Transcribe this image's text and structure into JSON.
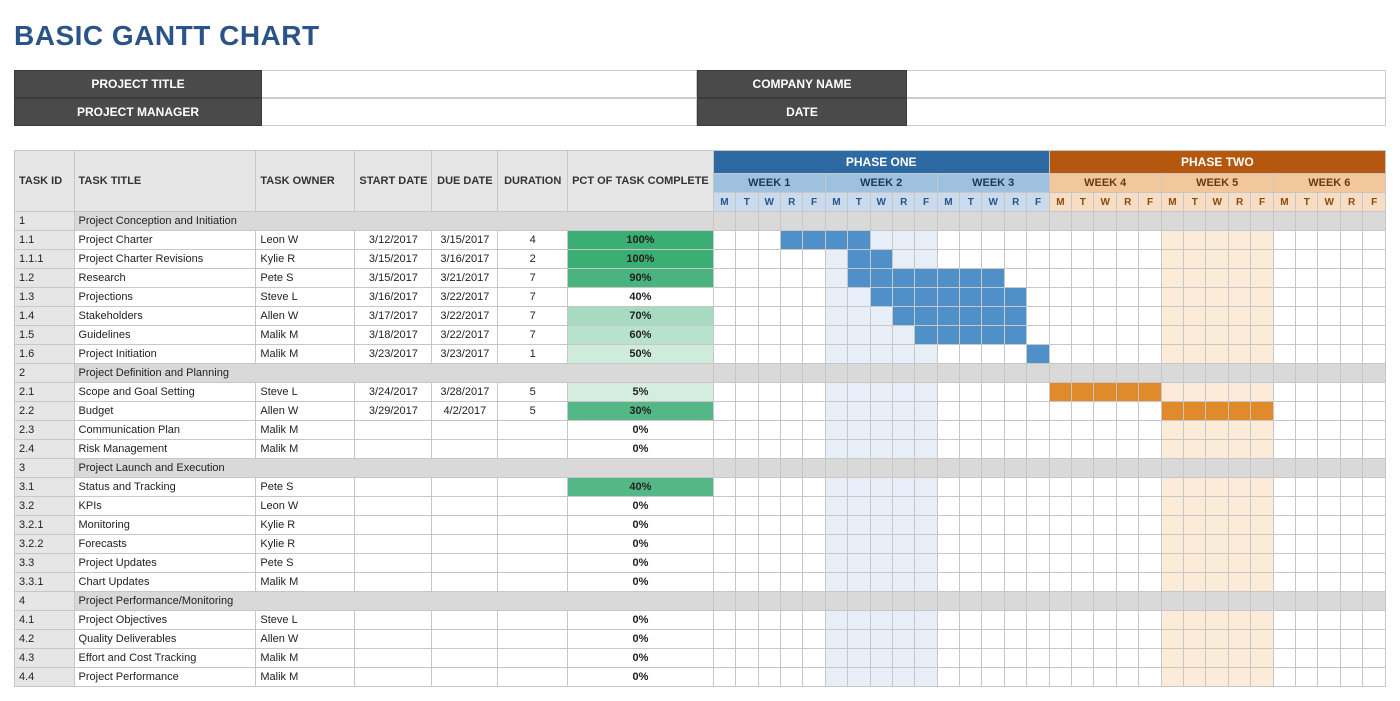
{
  "title": "BASIC GANTT CHART",
  "meta": {
    "project_title_label": "PROJECT TITLE",
    "project_title_value": "",
    "project_manager_label": "PROJECT MANAGER",
    "project_manager_value": "",
    "company_name_label": "COMPANY NAME",
    "company_name_value": "",
    "date_label": "DATE",
    "date_value": ""
  },
  "columns": {
    "task_id": "TASK ID",
    "task_title": "TASK TITLE",
    "task_owner": "TASK OWNER",
    "start_date": "START DATE",
    "due_date": "DUE DATE",
    "duration": "DURATION",
    "pct": "PCT OF TASK COMPLETE"
  },
  "phases": [
    {
      "label": "PHASE ONE",
      "weeks": [
        "WEEK 1",
        "WEEK 2",
        "WEEK 3"
      ],
      "color": "blue"
    },
    {
      "label": "PHASE TWO",
      "weeks": [
        "WEEK 4",
        "WEEK 5",
        "WEEK 6"
      ],
      "color": "orange"
    }
  ],
  "days": [
    "M",
    "T",
    "W",
    "R",
    "F"
  ],
  "shaded_blue_cols": [
    5,
    6,
    7,
    8,
    9
  ],
  "shaded_orange_cols": [
    20,
    21,
    22,
    23,
    24
  ],
  "rows": [
    {
      "section": true,
      "id": "1",
      "title": "Project Conception and Initiation"
    },
    {
      "id": "1.1",
      "title": "Project Charter",
      "owner": "Leon W",
      "start": "3/12/2017",
      "due": "3/15/2017",
      "dur": "4",
      "pct": "100%",
      "pctShade": 1.0,
      "bar": [
        3,
        4,
        5,
        6
      ]
    },
    {
      "id": "1.1.1",
      "title": "Project Charter Revisions",
      "owner": "Kylie R",
      "start": "3/15/2017",
      "due": "3/16/2017",
      "dur": "2",
      "pct": "100%",
      "pctShade": 1.0,
      "bar": [
        6,
        7
      ]
    },
    {
      "id": "1.2",
      "title": "Research",
      "owner": "Pete S",
      "start": "3/15/2017",
      "due": "3/21/2017",
      "dur": "7",
      "pct": "90%",
      "pctShade": 0.9,
      "bar": [
        6,
        7,
        8,
        9,
        10,
        11,
        12
      ]
    },
    {
      "id": "1.3",
      "title": "Projections",
      "owner": "Steve L",
      "start": "3/16/2017",
      "due": "3/22/2017",
      "dur": "7",
      "pct": "40%",
      "pctShade": 0.0,
      "bar": [
        7,
        8,
        9,
        10,
        11,
        12,
        13
      ]
    },
    {
      "id": "1.4",
      "title": "Stakeholders",
      "owner": "Allen W",
      "start": "3/17/2017",
      "due": "3/22/2017",
      "dur": "7",
      "pct": "70%",
      "pctShade": 0.35,
      "bar": [
        8,
        9,
        10,
        11,
        12,
        13
      ]
    },
    {
      "id": "1.5",
      "title": "Guidelines",
      "owner": "Malik M",
      "start": "3/18/2017",
      "due": "3/22/2017",
      "dur": "7",
      "pct": "60%",
      "pctShade": 0.25,
      "bar": [
        9,
        10,
        11,
        12,
        13
      ]
    },
    {
      "id": "1.6",
      "title": "Project Initiation",
      "owner": "Malik M",
      "start": "3/23/2017",
      "due": "3/23/2017",
      "dur": "1",
      "pct": "50%",
      "pctShade": 0.12,
      "bar": [
        14
      ]
    },
    {
      "section": true,
      "id": "2",
      "title": "Project Definition and Planning"
    },
    {
      "id": "2.1",
      "title": "Scope and Goal Setting",
      "owner": "Steve L",
      "start": "3/24/2017",
      "due": "3/28/2017",
      "dur": "5",
      "pct": "5%",
      "pctShade": 0.08,
      "bar": [
        15,
        16,
        17,
        18,
        19
      ]
    },
    {
      "id": "2.2",
      "title": "Budget",
      "owner": "Allen W",
      "start": "3/29/2017",
      "due": "4/2/2017",
      "dur": "5",
      "pct": "30%",
      "pctShade": 0.85,
      "bar": [
        20,
        21,
        22,
        23,
        24
      ]
    },
    {
      "id": "2.3",
      "title": "Communication Plan",
      "owner": "Malik M",
      "start": "",
      "due": "",
      "dur": "",
      "pct": "0%",
      "pctShade": 0.0,
      "bar": []
    },
    {
      "id": "2.4",
      "title": "Risk Management",
      "owner": "Malik M",
      "start": "",
      "due": "",
      "dur": "",
      "pct": "0%",
      "pctShade": 0.0,
      "bar": []
    },
    {
      "section": true,
      "id": "3",
      "title": "Project Launch and Execution"
    },
    {
      "id": "3.1",
      "title": "Status and Tracking",
      "owner": "Pete S",
      "start": "",
      "due": "",
      "dur": "",
      "pct": "40%",
      "pctShade": 0.85,
      "bar": []
    },
    {
      "id": "3.2",
      "title": "KPIs",
      "owner": "Leon W",
      "start": "",
      "due": "",
      "dur": "",
      "pct": "0%",
      "pctShade": 0.0,
      "bar": []
    },
    {
      "id": "3.2.1",
      "title": "Monitoring",
      "owner": "Kylie R",
      "start": "",
      "due": "",
      "dur": "",
      "pct": "0%",
      "pctShade": 0.0,
      "bar": []
    },
    {
      "id": "3.2.2",
      "title": "Forecasts",
      "owner": "Kylie R",
      "start": "",
      "due": "",
      "dur": "",
      "pct": "0%",
      "pctShade": 0.0,
      "bar": []
    },
    {
      "id": "3.3",
      "title": "Project Updates",
      "owner": "Pete S",
      "start": "",
      "due": "",
      "dur": "",
      "pct": "0%",
      "pctShade": 0.0,
      "bar": []
    },
    {
      "id": "3.3.1",
      "title": "Chart Updates",
      "owner": "Malik M",
      "start": "",
      "due": "",
      "dur": "",
      "pct": "0%",
      "pctShade": 0.0,
      "bar": []
    },
    {
      "section": true,
      "id": "4",
      "title": "Project Performance/Monitoring"
    },
    {
      "id": "4.1",
      "title": "Project Objectives",
      "owner": "Steve L",
      "start": "",
      "due": "",
      "dur": "",
      "pct": "0%",
      "pctShade": 0.0,
      "bar": []
    },
    {
      "id": "4.2",
      "title": "Quality Deliverables",
      "owner": "Allen W",
      "start": "",
      "due": "",
      "dur": "",
      "pct": "0%",
      "pctShade": 0.0,
      "bar": []
    },
    {
      "id": "4.3",
      "title": "Effort and Cost Tracking",
      "owner": "Malik M",
      "start": "",
      "due": "",
      "dur": "",
      "pct": "0%",
      "pctShade": 0.0,
      "bar": []
    },
    {
      "id": "4.4",
      "title": "Project Performance",
      "owner": "Malik M",
      "start": "",
      "due": "",
      "dur": "",
      "pct": "0%",
      "pctShade": 0.0,
      "bar": []
    }
  ],
  "chart_data": {
    "type": "gantt",
    "title": "BASIC GANTT CHART",
    "x_axis": {
      "unit": "weekday",
      "labels": [
        "M",
        "T",
        "W",
        "R",
        "F"
      ],
      "weeks": [
        "WEEK 1",
        "WEEK 2",
        "WEEK 3",
        "WEEK 4",
        "WEEK 5",
        "WEEK 6"
      ],
      "phases": [
        {
          "name": "PHASE ONE",
          "weeks": [
            1,
            2,
            3
          ]
        },
        {
          "name": "PHASE TWO",
          "weeks": [
            4,
            5,
            6
          ]
        }
      ]
    },
    "tasks": [
      {
        "id": "1.1",
        "title": "Project Charter",
        "owner": "Leon W",
        "start": "3/12/2017",
        "end": "3/15/2017",
        "duration_days": 4,
        "pct_complete": 100,
        "bar_span_day_indices": [
          3,
          6
        ]
      },
      {
        "id": "1.1.1",
        "title": "Project Charter Revisions",
        "owner": "Kylie R",
        "start": "3/15/2017",
        "end": "3/16/2017",
        "duration_days": 2,
        "pct_complete": 100,
        "bar_span_day_indices": [
          6,
          7
        ]
      },
      {
        "id": "1.2",
        "title": "Research",
        "owner": "Pete S",
        "start": "3/15/2017",
        "end": "3/21/2017",
        "duration_days": 7,
        "pct_complete": 90,
        "bar_span_day_indices": [
          6,
          12
        ]
      },
      {
        "id": "1.3",
        "title": "Projections",
        "owner": "Steve L",
        "start": "3/16/2017",
        "end": "3/22/2017",
        "duration_days": 7,
        "pct_complete": 40,
        "bar_span_day_indices": [
          7,
          13
        ]
      },
      {
        "id": "1.4",
        "title": "Stakeholders",
        "owner": "Allen W",
        "start": "3/17/2017",
        "end": "3/22/2017",
        "duration_days": 7,
        "pct_complete": 70,
        "bar_span_day_indices": [
          8,
          13
        ]
      },
      {
        "id": "1.5",
        "title": "Guidelines",
        "owner": "Malik M",
        "start": "3/18/2017",
        "end": "3/22/2017",
        "duration_days": 7,
        "pct_complete": 60,
        "bar_span_day_indices": [
          9,
          13
        ]
      },
      {
        "id": "1.6",
        "title": "Project Initiation",
        "owner": "Malik M",
        "start": "3/23/2017",
        "end": "3/23/2017",
        "duration_days": 1,
        "pct_complete": 50,
        "bar_span_day_indices": [
          14,
          14
        ]
      },
      {
        "id": "2.1",
        "title": "Scope and Goal Setting",
        "owner": "Steve L",
        "start": "3/24/2017",
        "end": "3/28/2017",
        "duration_days": 5,
        "pct_complete": 5,
        "bar_span_day_indices": [
          15,
          19
        ]
      },
      {
        "id": "2.2",
        "title": "Budget",
        "owner": "Allen W",
        "start": "3/29/2017",
        "end": "4/2/2017",
        "duration_days": 5,
        "pct_complete": 30,
        "bar_span_day_indices": [
          20,
          24
        ]
      },
      {
        "id": "2.3",
        "title": "Communication Plan",
        "owner": "Malik M",
        "pct_complete": 0
      },
      {
        "id": "2.4",
        "title": "Risk Management",
        "owner": "Malik M",
        "pct_complete": 0
      },
      {
        "id": "3.1",
        "title": "Status and Tracking",
        "owner": "Pete S",
        "pct_complete": 40
      },
      {
        "id": "3.2",
        "title": "KPIs",
        "owner": "Leon W",
        "pct_complete": 0
      },
      {
        "id": "3.2.1",
        "title": "Monitoring",
        "owner": "Kylie R",
        "pct_complete": 0
      },
      {
        "id": "3.2.2",
        "title": "Forecasts",
        "owner": "Kylie R",
        "pct_complete": 0
      },
      {
        "id": "3.3",
        "title": "Project Updates",
        "owner": "Pete S",
        "pct_complete": 0
      },
      {
        "id": "3.3.1",
        "title": "Chart Updates",
        "owner": "Malik M",
        "pct_complete": 0
      },
      {
        "id": "4.1",
        "title": "Project Objectives",
        "owner": "Steve L",
        "pct_complete": 0
      },
      {
        "id": "4.2",
        "title": "Quality Deliverables",
        "owner": "Allen W",
        "pct_complete": 0
      },
      {
        "id": "4.3",
        "title": "Effort and Cost Tracking",
        "owner": "Malik M",
        "pct_complete": 0
      },
      {
        "id": "4.4",
        "title": "Project Performance",
        "owner": "Malik M",
        "pct_complete": 0
      }
    ]
  }
}
